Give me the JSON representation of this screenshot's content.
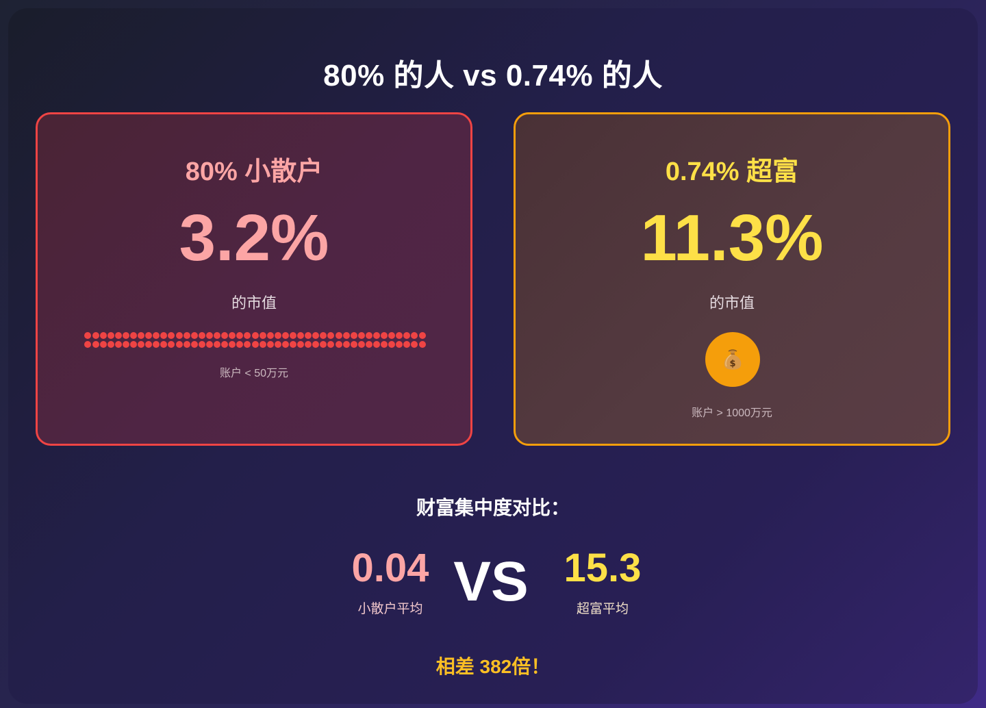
{
  "title": "80% 的人 vs 0.74% 的人",
  "left_card": {
    "title": "80% 小散户",
    "value": "3.2%",
    "label": "的市值",
    "note": "账户 < 50万元",
    "accent": "#ef4444"
  },
  "right_card": {
    "title": "0.74% 超富",
    "value": "11.3%",
    "label": "的市值",
    "icon": "money-bag-icon",
    "note": "账户 > 1000万元",
    "accent": "#f59e0b"
  },
  "comparison": {
    "title": "财富集中度对比：",
    "left_value": "0.04",
    "left_label": "小散户平均",
    "vs": "VS",
    "right_value": "15.3",
    "right_label": "超富平均",
    "difference": "相差 382倍！"
  }
}
